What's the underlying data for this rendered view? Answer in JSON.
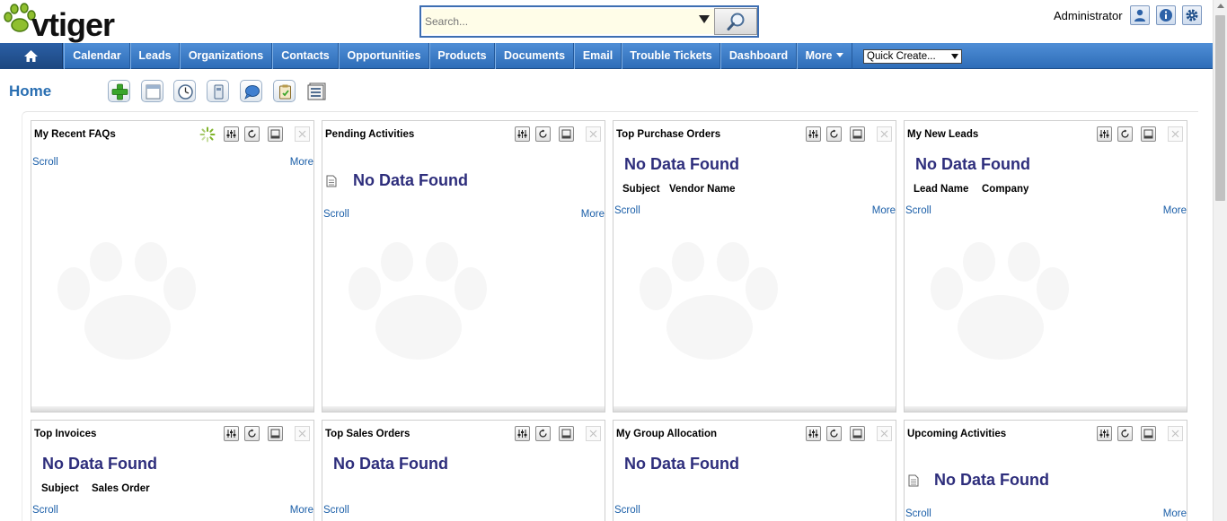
{
  "header": {
    "logo_text": "vtiger",
    "search_placeholder": "Search...",
    "admin_label": "Administrator"
  },
  "nav": {
    "items": [
      "Calendar",
      "Leads",
      "Organizations",
      "Contacts",
      "Opportunities",
      "Products",
      "Documents",
      "Email",
      "Trouble Tickets",
      "Dashboard",
      "More"
    ],
    "quick_create": "Quick Create..."
  },
  "page": {
    "title": "Home"
  },
  "widgets": [
    {
      "title": "My Recent FAQs",
      "scroll": "Scroll",
      "more": "More"
    },
    {
      "title": "Pending Activities",
      "nodata": "No Data Found",
      "scroll": "Scroll",
      "more": "More"
    },
    {
      "title": "Top Purchase Orders",
      "nodata": "No Data Found",
      "columns": [
        "Subject",
        "Vendor Name"
      ],
      "scroll": "Scroll",
      "more": "More"
    },
    {
      "title": "My New Leads",
      "nodata": "No Data Found",
      "columns": [
        "Lead Name",
        "Company"
      ],
      "scroll": "Scroll",
      "more": "More"
    },
    {
      "title": "Top Invoices",
      "nodata": "No Data Found",
      "columns": [
        "Subject",
        "Sales Order"
      ],
      "scroll": "Scroll",
      "more": "More"
    },
    {
      "title": "Top Sales Orders",
      "nodata": "No Data Found",
      "scroll": "Scroll"
    },
    {
      "title": "My Group Allocation",
      "nodata": "No Data Found",
      "scroll": "Scroll"
    },
    {
      "title": "Upcoming Activities",
      "nodata": "No Data Found",
      "scroll": "Scroll",
      "more": "More"
    }
  ],
  "colors": {
    "nav_blue": "#3a7cc8",
    "link_blue": "#1a5ea8",
    "nodata_text": "#2e2e7c",
    "home_title": "#2a6fb2"
  },
  "icons": {
    "header": [
      "user-profile-icon",
      "info-icon",
      "settings-gear-icon"
    ],
    "toolbar": [
      "add-widget-icon",
      "layout-icon",
      "clock-icon",
      "notebook-icon",
      "chat-bubble-icon",
      "clipboard-icon",
      "list-icon"
    ],
    "widget": [
      "loading-spinner-icon",
      "edit-settings-icon",
      "refresh-icon",
      "minimize-icon",
      "close-icon"
    ]
  }
}
